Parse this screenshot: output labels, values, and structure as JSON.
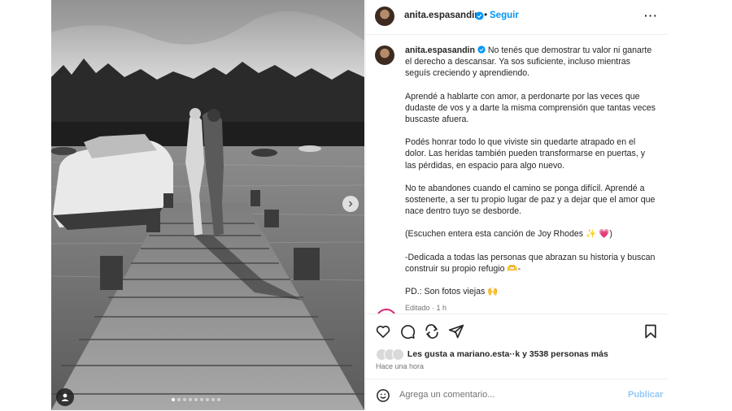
{
  "post": {
    "username": "anita.espasandin",
    "separator": "•",
    "follow_label": "Seguir",
    "more_label": "···",
    "caption": {
      "username": "anita.espasandin",
      "paragraphs": [
        "No tenés que demostrar tu valor ni ganarte el derecho a descansar. Ya sos suficiente, incluso mientras seguís creciendo y aprendiendo.",
        "Aprendé a hablarte con amor, a perdonarte por las veces que dudaste de vos y a darte la misma comprensión que tantas veces buscaste afuera.",
        "Podés honrar todo lo que viviste sin quedarte atrapado en el dolor. Las heridas también pueden transformarse en puertas, y las pérdidas, en espacio para algo nuevo.",
        "No te abandones cuando el camino se ponga difícil. Aprendé a sostenerte, a ser tu propio lugar de paz y a dejar que el amor que nace dentro tuyo se desborde.",
        "(Escuchen entera esta canción de Joy Rhodes ✨ 💗)",
        "-Dedicada a todas las personas que abrazan su historia y buscan construir su propio refugio 🫶-",
        "PD.: Son fotos viejas 🙌"
      ],
      "edited": "Editado · 1 h"
    },
    "likes_text": "Les gusta a mariano.esta··k y 3538 personas más",
    "time_text": "Hace una hora",
    "comment_placeholder": "Agrega un comentario...",
    "publish_label": "Publicar",
    "colors": {
      "accent": "#0095f6",
      "publish_disabled": "#91c9f7",
      "verified": "#0095f6"
    },
    "icons": [
      "verified-badge-icon",
      "more-options-icon",
      "like-heart-icon",
      "comment-icon",
      "share-icon",
      "send-icon",
      "save-bookmark-icon",
      "emoji-icon",
      "carousel-next-icon",
      "user-tag-icon"
    ],
    "carousel": {
      "total": 9,
      "active": 1
    }
  }
}
